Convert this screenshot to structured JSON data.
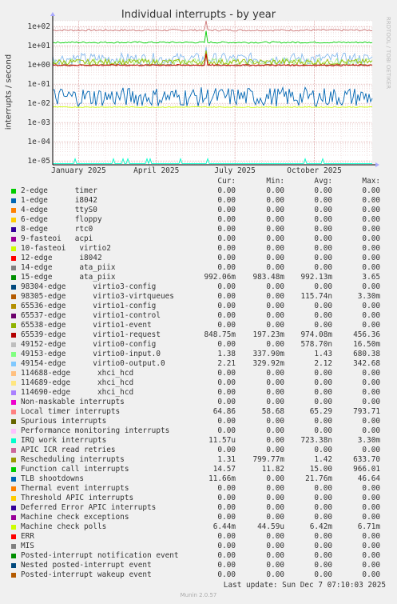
{
  "title": "Individual interrupts - by year",
  "ylabel": "interrupts / second",
  "watermark": "RRDTOOL / TOBI OETIKER",
  "footer": "Munin 2.0.57",
  "last_update": "Last update:  Sun Dec  7 07:10:03 2025",
  "columns": [
    "Cur:",
    "Min:",
    "Avg:",
    "Max:"
  ],
  "chart_data": {
    "type": "line",
    "title": "Individual interrupts - by year",
    "ylabel": "interrupts / second",
    "xlabel": "",
    "yscale": "log",
    "ylim": [
      6.3e-06,
      200
    ],
    "yticks": [
      {
        "v": 100,
        "label": "1e+02"
      },
      {
        "v": 10,
        "label": "1e+01"
      },
      {
        "v": 1,
        "label": "1e+00"
      },
      {
        "v": 0.1,
        "label": "1e-01"
      },
      {
        "v": 0.01,
        "label": "1e-02"
      },
      {
        "v": 0.001,
        "label": "1e-03"
      },
      {
        "v": 0.0001,
        "label": "1e-04"
      },
      {
        "v": 1e-05,
        "label": "1e-05"
      }
    ],
    "xrange": [
      "2024-12-02",
      "2025-12-07"
    ],
    "xticks": [
      {
        "date": "2025-01-01",
        "label": "January 2025"
      },
      {
        "date": "2025-04-01",
        "label": "April 2025"
      },
      {
        "date": "2025-07-01",
        "label": "July 2025"
      },
      {
        "date": "2025-10-01",
        "label": "October 2025"
      }
    ],
    "grid": true,
    "series_levels": [
      {
        "name": "Local timer interrupts",
        "color": "#cc7777",
        "level": 64.86,
        "noise": 0.05
      },
      {
        "name": "Function call interrupts",
        "color": "#00cc00",
        "level": 15.0,
        "noise": 0.04
      },
      {
        "name": "49154-edge virtio0-output.0",
        "color": "#88bbee",
        "level": 2.12,
        "noise": 0.3
      },
      {
        "name": "49153-edge virtio0-input.0",
        "color": "#aaee88",
        "level": 1.43,
        "noise": 0.2
      },
      {
        "name": "Rescheduling interrupts",
        "color": "#99bb00",
        "level": 1.42,
        "noise": 0.15
      },
      {
        "name": "15-edge ata_piix",
        "color": "#8a5a2a",
        "level": 0.992,
        "noise": 0.03
      },
      {
        "name": "65539-edge virtio1-request",
        "color": "#cc0000",
        "level": 0.974,
        "noise": 0.04
      },
      {
        "name": "TLB shootdowns",
        "color": "#0066b3",
        "level": 0.0217,
        "noise": 0.5
      },
      {
        "name": "Machine check polls",
        "color": "#ccff00",
        "level": 0.0064,
        "noise": 0.02
      },
      {
        "name": "IRQ work interrupts",
        "color": "#00ffcc",
        "level": 7.2e-06,
        "noise": 0.0
      }
    ]
  },
  "legend": [
    {
      "name": "2-edge      timer",
      "color": "#00cc00",
      "cur": "0.00",
      "min": "0.00",
      "avg": "0.00",
      "max": "0.00"
    },
    {
      "name": "1-edge      i8042",
      "color": "#0066b3",
      "cur": "0.00",
      "min": "0.00",
      "avg": "0.00",
      "max": "0.00"
    },
    {
      "name": "4-edge      ttyS0",
      "color": "#ff8000",
      "cur": "0.00",
      "min": "0.00",
      "avg": "0.00",
      "max": "0.00"
    },
    {
      "name": "6-edge      floppy",
      "color": "#ffcc00",
      "cur": "0.00",
      "min": "0.00",
      "avg": "0.00",
      "max": "0.00"
    },
    {
      "name": "8-edge      rtc0",
      "color": "#330099",
      "cur": "0.00",
      "min": "0.00",
      "avg": "0.00",
      "max": "0.00"
    },
    {
      "name": "9-fasteoi   acpi",
      "color": "#990099",
      "cur": "0.00",
      "min": "0.00",
      "avg": "0.00",
      "max": "0.00"
    },
    {
      "name": "10-fasteoi   virtio2",
      "color": "#ccff00",
      "cur": "0.00",
      "min": "0.00",
      "avg": "0.00",
      "max": "0.00"
    },
    {
      "name": "12-edge      i8042",
      "color": "#ff0000",
      "cur": "0.00",
      "min": "0.00",
      "avg": "0.00",
      "max": "0.00"
    },
    {
      "name": "14-edge      ata_piix",
      "color": "#808080",
      "cur": "0.00",
      "min": "0.00",
      "avg": "0.00",
      "max": "0.00"
    },
    {
      "name": "15-edge      ata_piix",
      "color": "#008f00",
      "cur": "992.06m",
      "min": "983.48m",
      "avg": "992.13m",
      "max": "3.65"
    },
    {
      "name": "98304-edge      virtio3-config",
      "color": "#00487d",
      "cur": "0.00",
      "min": "0.00",
      "avg": "0.00",
      "max": "0.00"
    },
    {
      "name": "98305-edge      virtio3-virtqueues",
      "color": "#b35a00",
      "cur": "0.00",
      "min": "0.00",
      "avg": "115.74n",
      "max": "3.30m"
    },
    {
      "name": "65536-edge      virtio1-config",
      "color": "#b38f00",
      "cur": "0.00",
      "min": "0.00",
      "avg": "0.00",
      "max": "0.00"
    },
    {
      "name": "65537-edge      virtio1-control",
      "color": "#6b006b",
      "cur": "0.00",
      "min": "0.00",
      "avg": "0.00",
      "max": "0.00"
    },
    {
      "name": "65538-edge      virtio1-event",
      "color": "#8fb300",
      "cur": "0.00",
      "min": "0.00",
      "avg": "0.00",
      "max": "0.00"
    },
    {
      "name": "65539-edge      virtio1-request",
      "color": "#b30000",
      "cur": "848.75m",
      "min": "197.23m",
      "avg": "974.08m",
      "max": "456.36"
    },
    {
      "name": "49152-edge      virtio0-config",
      "color": "#bebebe",
      "cur": "0.00",
      "min": "0.00",
      "avg": "578.70n",
      "max": "16.50m"
    },
    {
      "name": "49153-edge      virtio0-input.0",
      "color": "#80ff80",
      "cur": "1.38",
      "min": "337.90m",
      "avg": "1.43",
      "max": "680.38"
    },
    {
      "name": "49154-edge      virtio0-output.0",
      "color": "#80c9ff",
      "cur": "2.21",
      "min": "329.92m",
      "avg": "2.12",
      "max": "342.68"
    },
    {
      "name": "114688-edge      xhci_hcd",
      "color": "#ffc080",
      "cur": "0.00",
      "min": "0.00",
      "avg": "0.00",
      "max": "0.00"
    },
    {
      "name": "114689-edge      xhci_hcd",
      "color": "#ffe680",
      "cur": "0.00",
      "min": "0.00",
      "avg": "0.00",
      "max": "0.00"
    },
    {
      "name": "114690-edge      xhci_hcd",
      "color": "#aa80ff",
      "cur": "0.00",
      "min": "0.00",
      "avg": "0.00",
      "max": "0.00"
    },
    {
      "name": "Non-maskable interrupts",
      "color": "#ee00cc",
      "cur": "0.00",
      "min": "0.00",
      "avg": "0.00",
      "max": "0.00"
    },
    {
      "name": "Local timer interrupts",
      "color": "#ff8080",
      "cur": "64.86",
      "min": "58.68",
      "avg": "65.29",
      "max": "793.71"
    },
    {
      "name": "Spurious interrupts",
      "color": "#666600",
      "cur": "0.00",
      "min": "0.00",
      "avg": "0.00",
      "max": "0.00"
    },
    {
      "name": "Performance monitoring interrupts",
      "color": "#ffbfff",
      "cur": "0.00",
      "min": "0.00",
      "avg": "0.00",
      "max": "0.00"
    },
    {
      "name": "IRQ work interrupts",
      "color": "#00ffcc",
      "cur": "11.57u",
      "min": "0.00",
      "avg": "723.38n",
      "max": "3.30m"
    },
    {
      "name": "APIC ICR read retries",
      "color": "#cc6699",
      "cur": "0.00",
      "min": "0.00",
      "avg": "0.00",
      "max": "0.00"
    },
    {
      "name": "Rescheduling interrupts",
      "color": "#999900",
      "cur": "1.31",
      "min": "799.77m",
      "avg": "1.42",
      "max": "633.70"
    },
    {
      "name": "Function call interrupts",
      "color": "#00cc00",
      "cur": "14.57",
      "min": "11.82",
      "avg": "15.00",
      "max": "966.01"
    },
    {
      "name": "TLB shootdowns",
      "color": "#0066b3",
      "cur": "11.66m",
      "min": "0.00",
      "avg": "21.76m",
      "max": "46.64"
    },
    {
      "name": "Thermal event interrupts",
      "color": "#ff8000",
      "cur": "0.00",
      "min": "0.00",
      "avg": "0.00",
      "max": "0.00"
    },
    {
      "name": "Threshold APIC interrupts",
      "color": "#ffcc00",
      "cur": "0.00",
      "min": "0.00",
      "avg": "0.00",
      "max": "0.00"
    },
    {
      "name": "Deferred Error APIC interrupts",
      "color": "#330099",
      "cur": "0.00",
      "min": "0.00",
      "avg": "0.00",
      "max": "0.00"
    },
    {
      "name": "Machine check exceptions",
      "color": "#990099",
      "cur": "0.00",
      "min": "0.00",
      "avg": "0.00",
      "max": "0.00"
    },
    {
      "name": "Machine check polls",
      "color": "#ccff00",
      "cur": "6.44m",
      "min": "44.59u",
      "avg": "6.42m",
      "max": "6.71m"
    },
    {
      "name": "ERR",
      "color": "#ff0000",
      "cur": "0.00",
      "min": "0.00",
      "avg": "0.00",
      "max": "0.00"
    },
    {
      "name": "MIS",
      "color": "#808080",
      "cur": "0.00",
      "min": "0.00",
      "avg": "0.00",
      "max": "0.00"
    },
    {
      "name": "Posted-interrupt notification event",
      "color": "#008f00",
      "cur": "0.00",
      "min": "0.00",
      "avg": "0.00",
      "max": "0.00"
    },
    {
      "name": "Nested posted-interrupt event",
      "color": "#00487d",
      "cur": "0.00",
      "min": "0.00",
      "avg": "0.00",
      "max": "0.00"
    },
    {
      "name": "Posted-interrupt wakeup event",
      "color": "#b35a00",
      "cur": "0.00",
      "min": "0.00",
      "avg": "0.00",
      "max": "0.00"
    }
  ]
}
